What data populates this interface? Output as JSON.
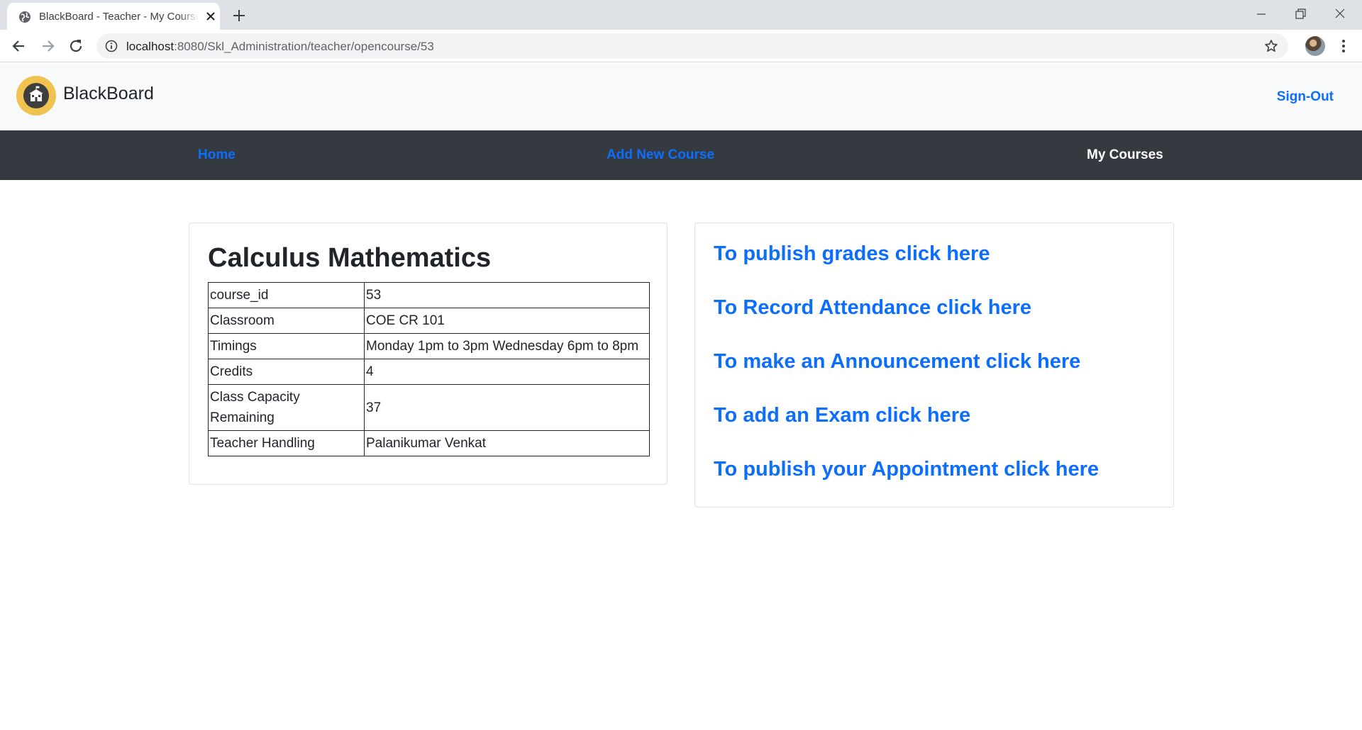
{
  "browser": {
    "tab_title": "BlackBoard - Teacher - My Courses",
    "url_host": "localhost",
    "url_path": ":8080/Skl_Administration/teacher/opencourse/53"
  },
  "header": {
    "brand": "BlackBoard",
    "signout_label": "Sign-Out"
  },
  "nav": {
    "items": [
      {
        "label": "Home",
        "active": false
      },
      {
        "label": "Add New Course",
        "active": false
      },
      {
        "label": "My Courses",
        "active": true
      }
    ]
  },
  "course": {
    "title": "Calculus Mathematics",
    "rows": [
      {
        "key": "course_id",
        "value": "53"
      },
      {
        "key": "Classroom",
        "value": "COE CR 101"
      },
      {
        "key": "Timings",
        "value": "Monday 1pm to 3pm Wednesday 6pm to 8pm"
      },
      {
        "key": "Credits",
        "value": "4"
      },
      {
        "key": "Class Capacity Remaining",
        "value": "37"
      },
      {
        "key": "Teacher Handling",
        "value": "Palanikumar Venkat"
      }
    ]
  },
  "actions": [
    "To publish grades click here",
    "To Record Attendance click here",
    "To make an Announcement click here",
    "To add an Exam click here",
    "To publish your Appointment click here"
  ],
  "colors": {
    "link": "#0d6efd",
    "nav_bg": "#343a40",
    "header_bg": "#f8f9fa",
    "logo": "#f0c24f"
  }
}
